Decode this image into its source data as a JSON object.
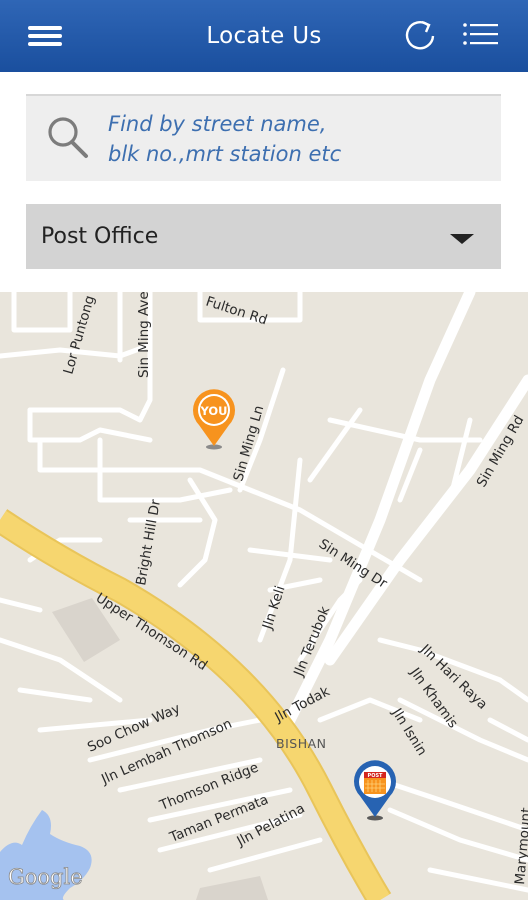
{
  "header": {
    "title": "Locate Us",
    "left_icon": "menu-icon",
    "right_icons": [
      "refresh-icon",
      "list-icon"
    ]
  },
  "search": {
    "placeholder_line1": "Find by street name,",
    "placeholder_line2": "blk no.,mrt station etc",
    "icon": "search-icon"
  },
  "filter": {
    "selected": "Post Office"
  },
  "map": {
    "streets": {
      "fulton_rd": "Fulton Rd",
      "lor_puntong": "Lor Puntong",
      "sin_ming_ave": "Sin Ming Ave",
      "sin_ming_ln": "Sin Ming Ln",
      "sin_ming_dr": "Sin Ming Dr",
      "sin_ming_rd": "Sin Ming Rd",
      "bright_hill_dr": "Bright Hill Dr",
      "upper_thomson_rd": "Upper Thomson Rd",
      "jln_keli": "Jln Keli",
      "jln_terubok": "Jln Terubok",
      "jln_todak": "Jln Todak",
      "jln_hari_raya": "Jln Hari Raya",
      "jln_khamis": "Jln Khamis",
      "jln_isnin": "Jln Isnin",
      "soo_chow_way": "Soo Chow Way",
      "jln_lembah_thomson": "Jln Lembah Thomson",
      "thomson_ridge": "Thomson Ridge",
      "taman_permata": "Taman Permata",
      "jln_pelatina": "Jln Pelatina",
      "bishan": "BISHAN",
      "marymount": "Marymount"
    },
    "you_marker_text": "YOU",
    "post_marker_text": "POST",
    "attribution": "Google",
    "colors": {
      "map_bg": "#e9e5dc",
      "road": "#ffffff",
      "highway": "#f4cf64",
      "water": "#a5c2ef",
      "you_marker": "#f7931e",
      "post_marker": "#2763b2"
    }
  }
}
